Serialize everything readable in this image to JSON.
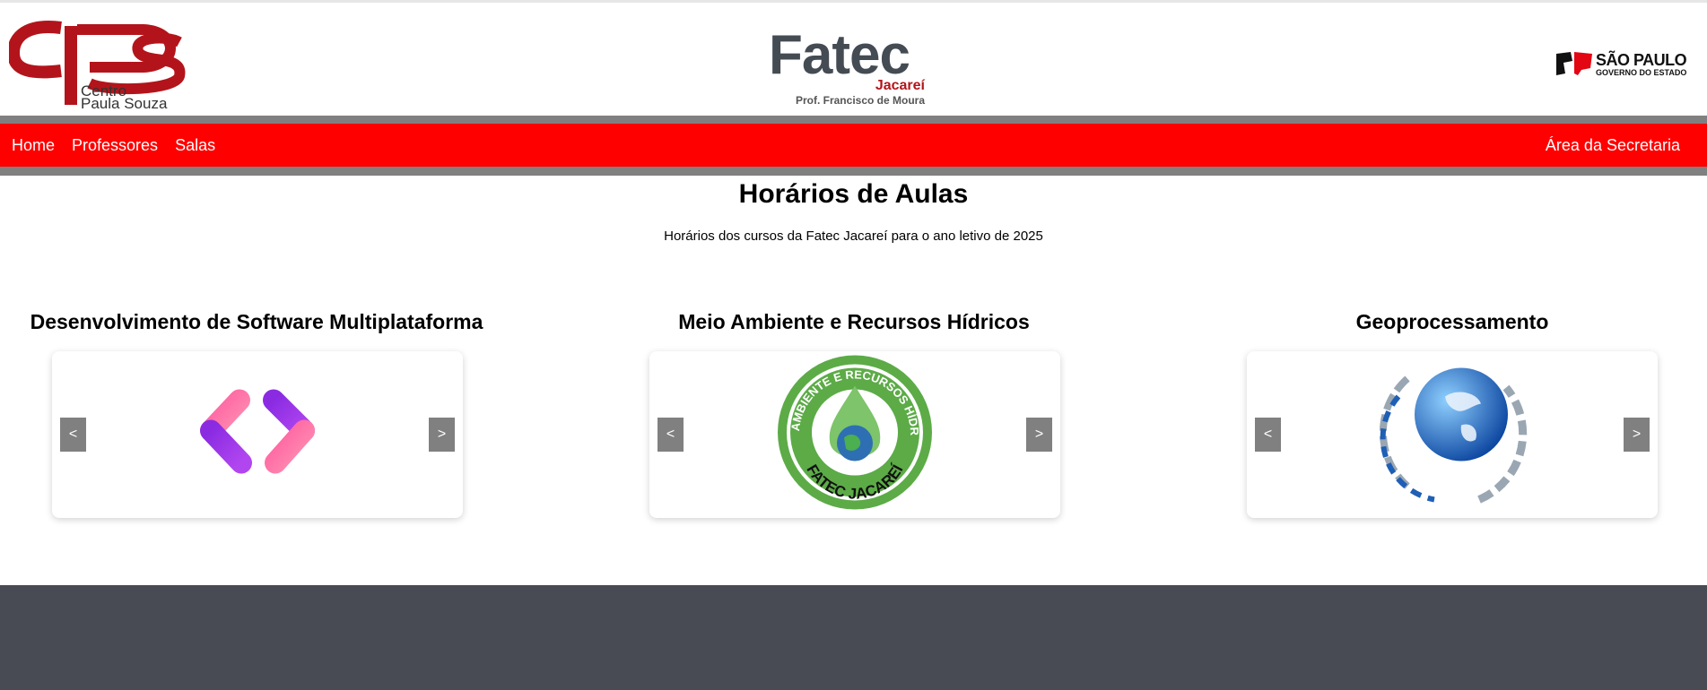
{
  "header": {
    "cps_logo": {
      "line1": "Centro",
      "line2": "Paula Souza"
    },
    "fatec_logo": {
      "name": "Fatec",
      "city": "Jacareí",
      "prof": "Prof. Francisco de Moura"
    },
    "sp_logo": {
      "name": "SÃO PAULO",
      "sub": "GOVERNO DO ESTADO"
    }
  },
  "nav": {
    "items": [
      {
        "label": "Home"
      },
      {
        "label": "Professores"
      },
      {
        "label": "Salas"
      }
    ],
    "right": {
      "label": "Área da Secretaria"
    }
  },
  "main": {
    "title": "Horários de Aulas",
    "subtitle": "Horários dos cursos da Fatec Jacareí para o ano letivo de 2025",
    "courses": [
      {
        "title": "Desenvolvimento de Software Multiplataforma",
        "image_icon": "code-brackets-icon",
        "prev": "<",
        "next": ">"
      },
      {
        "title": "Meio Ambiente e Recursos Hídricos",
        "image_icon": "environment-badge-icon",
        "badge_top": "MEIO AMBIENTE E RECURSOS HÍDRICOS",
        "badge_bottom": "FATEC JACAREÍ",
        "prev": "<",
        "next": ">"
      },
      {
        "title": "Geoprocessamento",
        "image_icon": "globe-icon",
        "prev": "<",
        "next": ">"
      }
    ]
  },
  "colors": {
    "nav_red": "#ff0000",
    "nav_border": "#808080",
    "footer": "#484b53",
    "brand_red": "#b3141b"
  }
}
